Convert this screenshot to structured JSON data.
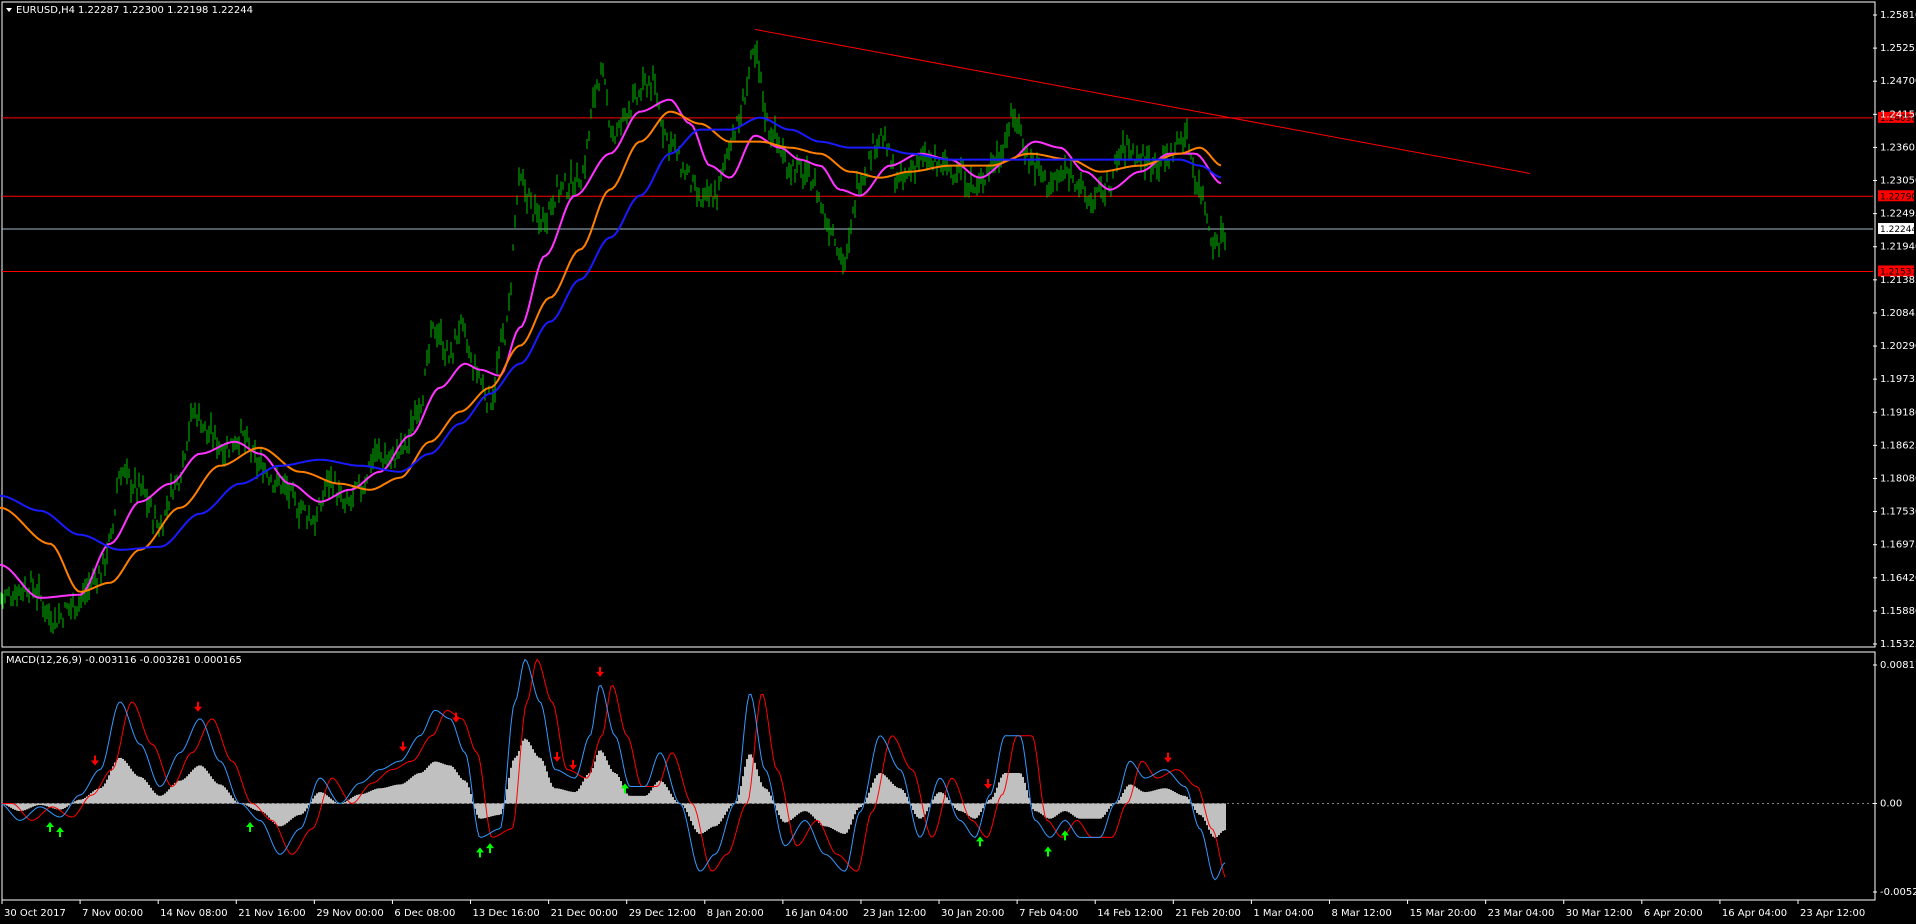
{
  "header": {
    "symbol": "EURUSD,H4",
    "ohlc": "1.22287 1.22300 1.22198 1.22244"
  },
  "macd_header": "MACD(12,26,9) -0.003116 -0.003281 0.000165",
  "colors": {
    "background": "#000000",
    "grid": "#ffffff",
    "bars": "#00c000",
    "ma_fast": "#ff33ff",
    "ma_mid": "#ff7f00",
    "ma_slow": "#1a1aff",
    "level_line": "#ff0000",
    "current_price_line": "#a0b8c8",
    "macd_hist": "#c0c0c0",
    "macd_main": "#3399ff",
    "macd_signal": "#ff0000",
    "arrow_up": "#00ff00",
    "arrow_down": "#ff0000"
  },
  "icons": {
    "menu": "triangle-down-icon",
    "arrow_up": "up-arrow-icon",
    "arrow_down": "down-arrow-icon"
  },
  "chart_data": [
    {
      "type": "line",
      "title": "EURUSD,H4",
      "ylim": [
        1.1533,
        1.2581
      ],
      "y_ticks": [
        "1.25810",
        "1.25255",
        "1.24700",
        "1.24150",
        "1.23605",
        "1.23050",
        "1.22495",
        "1.21940",
        "1.21385",
        "1.20845",
        "1.20290",
        "1.19735",
        "1.19180",
        "1.18625",
        "1.18080",
        "1.17530",
        "1.16975",
        "1.16420",
        "1.15880",
        "1.15325"
      ],
      "x_ticks": [
        "30 Oct 2017",
        "7 Nov 00:00",
        "14 Nov 08:00",
        "21 Nov 16:00",
        "29 Nov 00:00",
        "6 Dec 08:00",
        "13 Dec 16:00",
        "21 Dec 00:00",
        "29 Dec 12:00",
        "8 Jan 20:00",
        "16 Jan 04:00",
        "23 Jan 12:00",
        "30 Jan 20:00",
        "7 Feb 04:00",
        "14 Feb 12:00",
        "21 Feb 20:00",
        "1 Mar 04:00",
        "8 Mar 12:00",
        "15 Mar 20:00",
        "23 Mar 04:00",
        "30 Mar 12:00",
        "6 Apr 20:00",
        "16 Apr 04:00",
        "23 Apr 12:00"
      ],
      "price_anchors": [
        [
          0,
          1.161
        ],
        [
          30,
          1.163
        ],
        [
          55,
          1.1575
        ],
        [
          75,
          1.16
        ],
        [
          100,
          1.165
        ],
        [
          110,
          1.17
        ],
        [
          120,
          1.182
        ],
        [
          140,
          1.179
        ],
        [
          160,
          1.173
        ],
        [
          175,
          1.18
        ],
        [
          195,
          1.192
        ],
        [
          210,
          1.188
        ],
        [
          225,
          1.186
        ],
        [
          240,
          1.188
        ],
        [
          260,
          1.183
        ],
        [
          280,
          1.18
        ],
        [
          300,
          1.176
        ],
        [
          315,
          1.174
        ],
        [
          330,
          1.181
        ],
        [
          345,
          1.176
        ],
        [
          360,
          1.179
        ],
        [
          375,
          1.185
        ],
        [
          390,
          1.184
        ],
        [
          405,
          1.186
        ],
        [
          420,
          1.194
        ],
        [
          435,
          1.206
        ],
        [
          450,
          1.201
        ],
        [
          460,
          1.206
        ],
        [
          475,
          1.199
        ],
        [
          490,
          1.194
        ],
        [
          505,
          1.205
        ],
        [
          520,
          1.23
        ],
        [
          540,
          1.224
        ],
        [
          560,
          1.229
        ],
        [
          580,
          1.231
        ],
        [
          600,
          1.248
        ],
        [
          615,
          1.238
        ],
        [
          630,
          1.243
        ],
        [
          650,
          1.247
        ],
        [
          670,
          1.237
        ],
        [
          685,
          1.232
        ],
        [
          700,
          1.227
        ],
        [
          715,
          1.228
        ],
        [
          735,
          1.239
        ],
        [
          755,
          1.251
        ],
        [
          770,
          1.239
        ],
        [
          790,
          1.233
        ],
        [
          810,
          1.231
        ],
        [
          830,
          1.223
        ],
        [
          845,
          1.217
        ],
        [
          860,
          1.231
        ],
        [
          880,
          1.238
        ],
        [
          900,
          1.23
        ],
        [
          920,
          1.234
        ],
        [
          940,
          1.233
        ],
        [
          960,
          1.232
        ],
        [
          975,
          1.229
        ],
        [
          995,
          1.234
        ],
        [
          1015,
          1.241
        ],
        [
          1030,
          1.234
        ],
        [
          1050,
          1.23
        ],
        [
          1070,
          1.232
        ],
        [
          1090,
          1.227
        ],
        [
          1105,
          1.229
        ],
        [
          1125,
          1.236
        ],
        [
          1145,
          1.234
        ],
        [
          1165,
          1.234
        ],
        [
          1185,
          1.238
        ],
        [
          1200,
          1.229
        ],
        [
          1215,
          1.22
        ],
        [
          1225,
          1.2224
        ]
      ],
      "series": [
        {
          "name": "MA fast",
          "color_key": "ma_fast",
          "values": [
            [
              0,
              1.1665
            ],
            [
              40,
              1.161
            ],
            [
              80,
              1.1615
            ],
            [
              110,
              1.17
            ],
            [
              140,
              1.177
            ],
            [
              170,
              1.18
            ],
            [
              200,
              1.185
            ],
            [
              235,
              1.187
            ],
            [
              260,
              1.185
            ],
            [
              290,
              1.18
            ],
            [
              320,
              1.177
            ],
            [
              350,
              1.179
            ],
            [
              380,
              1.182
            ],
            [
              410,
              1.188
            ],
            [
              440,
              1.196
            ],
            [
              465,
              1.2
            ],
            [
              480,
              1.199
            ],
            [
              500,
              1.198
            ],
            [
              520,
              1.206
            ],
            [
              545,
              1.218
            ],
            [
              575,
              1.228
            ],
            [
              610,
              1.235
            ],
            [
              640,
              1.242
            ],
            [
              670,
              1.244
            ],
            [
              690,
              1.24
            ],
            [
              710,
              1.233
            ],
            [
              730,
              1.231
            ],
            [
              755,
              1.238
            ],
            [
              780,
              1.236
            ],
            [
              800,
              1.234
            ],
            [
              820,
              1.233
            ],
            [
              840,
              1.229
            ],
            [
              860,
              1.228
            ],
            [
              890,
              1.233
            ],
            [
              920,
              1.235
            ],
            [
              950,
              1.234
            ],
            [
              980,
              1.231
            ],
            [
              1010,
              1.234
            ],
            [
              1035,
              1.237
            ],
            [
              1060,
              1.236
            ],
            [
              1085,
              1.232
            ],
            [
              1110,
              1.229
            ],
            [
              1140,
              1.232
            ],
            [
              1170,
              1.235
            ],
            [
              1195,
              1.235
            ],
            [
              1222,
              1.23
            ]
          ]
        },
        {
          "name": "MA mid",
          "color_key": "ma_mid",
          "values": [
            [
              0,
              1.176
            ],
            [
              50,
              1.17
            ],
            [
              80,
              1.162
            ],
            [
              110,
              1.1635
            ],
            [
              140,
              1.169
            ],
            [
              180,
              1.176
            ],
            [
              220,
              1.183
            ],
            [
              260,
              1.186
            ],
            [
              300,
              1.182
            ],
            [
              340,
              1.18
            ],
            [
              370,
              1.179
            ],
            [
              400,
              1.181
            ],
            [
              430,
              1.187
            ],
            [
              460,
              1.192
            ],
            [
              490,
              1.196
            ],
            [
              520,
              1.203
            ],
            [
              550,
              1.211
            ],
            [
              580,
              1.219
            ],
            [
              610,
              1.229
            ],
            [
              640,
              1.237
            ],
            [
              670,
              1.242
            ],
            [
              700,
              1.24
            ],
            [
              730,
              1.237
            ],
            [
              760,
              1.237
            ],
            [
              790,
              1.236
            ],
            [
              820,
              1.235
            ],
            [
              850,
              1.232
            ],
            [
              880,
              1.231
            ],
            [
              910,
              1.232
            ],
            [
              950,
              1.233
            ],
            [
              990,
              1.233
            ],
            [
              1030,
              1.235
            ],
            [
              1070,
              1.234
            ],
            [
              1100,
              1.232
            ],
            [
              1140,
              1.233
            ],
            [
              1180,
              1.235
            ],
            [
              1200,
              1.236
            ],
            [
              1222,
              1.233
            ]
          ]
        },
        {
          "name": "MA slow",
          "color_key": "ma_slow",
          "values": [
            [
              0,
              1.178
            ],
            [
              40,
              1.1755
            ],
            [
              80,
              1.1715
            ],
            [
              120,
              1.169
            ],
            [
              160,
              1.1695
            ],
            [
              200,
              1.175
            ],
            [
              240,
              1.18
            ],
            [
              280,
              1.183
            ],
            [
              320,
              1.184
            ],
            [
              360,
              1.183
            ],
            [
              400,
              1.182
            ],
            [
              430,
              1.185
            ],
            [
              460,
              1.19
            ],
            [
              490,
              1.195
            ],
            [
              520,
              1.2
            ],
            [
              550,
              1.207
            ],
            [
              580,
              1.214
            ],
            [
              610,
              1.221
            ],
            [
              640,
              1.228
            ],
            [
              670,
              1.235
            ],
            [
              700,
              1.239
            ],
            [
              730,
              1.239
            ],
            [
              760,
              1.241
            ],
            [
              790,
              1.239
            ],
            [
              820,
              1.237
            ],
            [
              850,
              1.236
            ],
            [
              880,
              1.236
            ],
            [
              910,
              1.235
            ],
            [
              950,
              1.234
            ],
            [
              990,
              1.234
            ],
            [
              1030,
              1.234
            ],
            [
              1070,
              1.234
            ],
            [
              1100,
              1.234
            ],
            [
              1140,
              1.234
            ],
            [
              1180,
              1.234
            ],
            [
              1200,
              1.233
            ],
            [
              1222,
              1.231
            ]
          ]
        }
      ],
      "trendline": {
        "start": [
          755,
          1.2557
        ],
        "end": [
          1530,
          1.2317
        ]
      },
      "price_levels": [
        {
          "label": "1.24096",
          "value": 1.24096
        },
        {
          "label": "1.22790",
          "value": 1.2279
        },
        {
          "label": "1.21537",
          "value": 1.21537
        }
      ],
      "current_price": {
        "label": "1.22244",
        "value": 1.22244
      }
    },
    {
      "type": "bar",
      "title": "MACD(12,26,9) -0.003116 -0.003281 0.000165",
      "ylim": [
        -0.005225,
        0.008173
      ],
      "y_ticks": [
        "0.008173",
        "0.00",
        "-0.005225"
      ],
      "macd_anchors": [
        [
          0,
          0.0
        ],
        [
          20,
          -0.001
        ],
        [
          40,
          -0.0002
        ],
        [
          60,
          -0.0008
        ],
        [
          80,
          0.0005
        ],
        [
          100,
          0.002
        ],
        [
          120,
          0.006
        ],
        [
          140,
          0.0035
        ],
        [
          160,
          0.001
        ],
        [
          180,
          0.003
        ],
        [
          200,
          0.005
        ],
        [
          220,
          0.0025
        ],
        [
          240,
          0.0
        ],
        [
          260,
          -0.001
        ],
        [
          280,
          -0.003
        ],
        [
          300,
          -0.0015
        ],
        [
          320,
          0.0015
        ],
        [
          340,
          0.0
        ],
        [
          360,
          0.0012
        ],
        [
          380,
          0.002
        ],
        [
          400,
          0.0025
        ],
        [
          420,
          0.004
        ],
        [
          435,
          0.0055
        ],
        [
          450,
          0.005
        ],
        [
          465,
          0.003
        ],
        [
          480,
          -0.002
        ],
        [
          500,
          -0.0015
        ],
        [
          515,
          0.006
        ],
        [
          525,
          0.0085
        ],
        [
          540,
          0.006
        ],
        [
          555,
          0.002
        ],
        [
          575,
          0.0015
        ],
        [
          590,
          0.004
        ],
        [
          600,
          0.007
        ],
        [
          615,
          0.004
        ],
        [
          630,
          0.001
        ],
        [
          645,
          0.001
        ],
        [
          660,
          0.003
        ],
        [
          680,
          0.0
        ],
        [
          700,
          -0.004
        ],
        [
          715,
          -0.003
        ],
        [
          735,
          0.0
        ],
        [
          750,
          0.0065
        ],
        [
          765,
          0.002
        ],
        [
          785,
          -0.0025
        ],
        [
          805,
          -0.001
        ],
        [
          825,
          -0.003
        ],
        [
          845,
          -0.004
        ],
        [
          860,
          -0.0005
        ],
        [
          880,
          0.004
        ],
        [
          900,
          0.002
        ],
        [
          920,
          -0.002
        ],
        [
          940,
          0.0015
        ],
        [
          960,
          -0.001
        ],
        [
          975,
          -0.002
        ],
        [
          990,
          0.0005
        ],
        [
          1005,
          0.004
        ],
        [
          1020,
          0.004
        ],
        [
          1035,
          -0.001
        ],
        [
          1050,
          -0.002
        ],
        [
          1065,
          -0.001
        ],
        [
          1080,
          -0.002
        ],
        [
          1100,
          -0.002
        ],
        [
          1115,
          0.0
        ],
        [
          1130,
          0.0025
        ],
        [
          1145,
          0.0015
        ],
        [
          1165,
          0.002
        ],
        [
          1185,
          0.001
        ],
        [
          1200,
          -0.0015
        ],
        [
          1215,
          -0.0045
        ],
        [
          1225,
          -0.0035
        ]
      ],
      "arrows_up": [
        50,
        60,
        250,
        480,
        490,
        625,
        980,
        1048,
        1065
      ],
      "arrows_down": [
        95,
        198,
        403,
        456,
        557,
        573,
        600,
        988,
        1168
      ]
    }
  ]
}
